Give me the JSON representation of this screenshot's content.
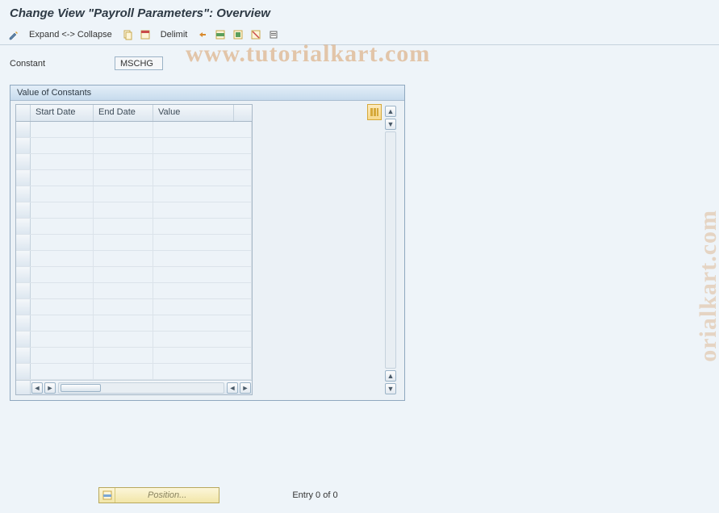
{
  "title": "Change View \"Payroll Parameters\": Overview",
  "toolbar": {
    "expand_collapse": "Expand <-> Collapse",
    "delimit": "Delimit"
  },
  "form": {
    "constant_label": "Constant",
    "constant_value": "MSCHG"
  },
  "panel": {
    "title": "Value of Constants",
    "columns": {
      "start_date": "Start Date",
      "end_date": "End Date",
      "value": "Value"
    },
    "rows": [
      {
        "start_date": "",
        "end_date": "",
        "value": ""
      },
      {
        "start_date": "",
        "end_date": "",
        "value": ""
      },
      {
        "start_date": "",
        "end_date": "",
        "value": ""
      },
      {
        "start_date": "",
        "end_date": "",
        "value": ""
      },
      {
        "start_date": "",
        "end_date": "",
        "value": ""
      },
      {
        "start_date": "",
        "end_date": "",
        "value": ""
      },
      {
        "start_date": "",
        "end_date": "",
        "value": ""
      },
      {
        "start_date": "",
        "end_date": "",
        "value": ""
      },
      {
        "start_date": "",
        "end_date": "",
        "value": ""
      },
      {
        "start_date": "",
        "end_date": "",
        "value": ""
      },
      {
        "start_date": "",
        "end_date": "",
        "value": ""
      },
      {
        "start_date": "",
        "end_date": "",
        "value": ""
      },
      {
        "start_date": "",
        "end_date": "",
        "value": ""
      },
      {
        "start_date": "",
        "end_date": "",
        "value": ""
      },
      {
        "start_date": "",
        "end_date": "",
        "value": ""
      },
      {
        "start_date": "",
        "end_date": "",
        "value": ""
      }
    ]
  },
  "footer": {
    "position_label": "Position...",
    "entry_text": "Entry 0 of 0"
  },
  "watermark": "www.tutorialkart.com",
  "watermark2": "orialkart.com"
}
